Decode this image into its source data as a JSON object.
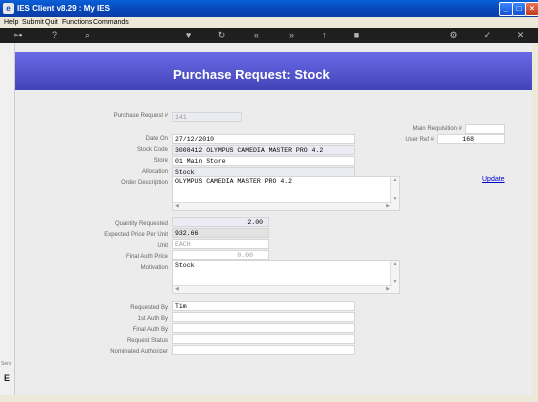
{
  "window": {
    "title": "IES Client v8.29 : My IES"
  },
  "menu": [
    "Help",
    "Submit",
    "Quit",
    "Functions",
    "Commands"
  ],
  "page": {
    "heading": "Purchase Request: Stock"
  },
  "form": {
    "purchase_request_no": {
      "label": "Purchase Request #",
      "value": "141"
    },
    "main_requisition_no": {
      "label": "Main Requisition #",
      "value": ""
    },
    "user_ref_no": {
      "label": "User Ref #",
      "value": "168"
    },
    "date_on": {
      "label": "Date On",
      "value": "27/12/2010"
    },
    "stock_code": {
      "label": "Stock Code",
      "value": "3008412 OLYMPUS CAMEDIA MASTER PRO 4.2"
    },
    "store": {
      "label": "Store",
      "value": "01 Main Store"
    },
    "allocation": {
      "label": "Allocation",
      "value": "Stock"
    },
    "order_description": {
      "label": "Order Description",
      "value": "OLYMPUS CAMEDIA MASTER PRO 4.2"
    },
    "update_link": "Update",
    "quantity_requested": {
      "label": "Quantity Requested",
      "value": "2.00"
    },
    "expected_price": {
      "label": "Expected Price Per Unit",
      "value": "932.66"
    },
    "unit": {
      "label": "Unit",
      "value": "EACH"
    },
    "final_auth_price": {
      "label": "Final Auth Price",
      "value": "0.00"
    },
    "motivation": {
      "label": "Motivation",
      "value": "Stock"
    },
    "requested_by": {
      "label": "Requested By",
      "value": "Tim"
    },
    "first_auth_by": {
      "label": "1st Auth By",
      "value": ""
    },
    "final_auth_by": {
      "label": "Final Auth By",
      "value": ""
    },
    "request_status": {
      "label": "Request Status",
      "value": ""
    },
    "nominated_authorizer": {
      "label": "Nominated Authorizer",
      "value": ""
    }
  },
  "sidebar": {
    "strip_label": "Serv",
    "logo": "E"
  }
}
